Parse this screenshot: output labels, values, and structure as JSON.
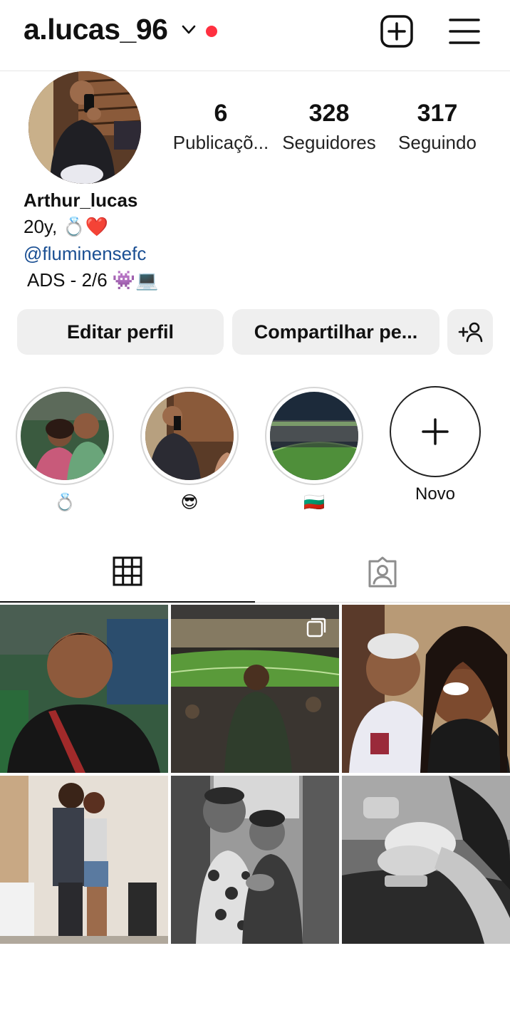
{
  "header": {
    "username": "a.lucas_96",
    "has_notification_dot": true,
    "notification_color": "#ff3040"
  },
  "profile": {
    "stats": [
      {
        "value": "6",
        "label": "Publicaçõ..."
      },
      {
        "value": "328",
        "label": "Seguidores"
      },
      {
        "value": "317",
        "label": "Seguindo"
      }
    ],
    "display_name": "Arthur_lucas",
    "bio_line1": "20y, 💍❤️",
    "bio_link": "@fluminensefc",
    "bio_line3": "ADS - 2/6 👾💻"
  },
  "actions": {
    "edit_label": "Editar perfil",
    "share_label": "Compartilhar pe...",
    "add_icon": "add-person-icon"
  },
  "highlights": [
    {
      "label": "💍"
    },
    {
      "label": "😎"
    },
    {
      "label": "🇧🇬"
    },
    {
      "label": "Novo"
    }
  ],
  "tabs": [
    {
      "icon": "grid-icon",
      "active": true
    },
    {
      "icon": "tagged-icon",
      "active": false
    }
  ],
  "colors": {
    "link": "#1a4f93",
    "button_bg": "#efefef"
  }
}
